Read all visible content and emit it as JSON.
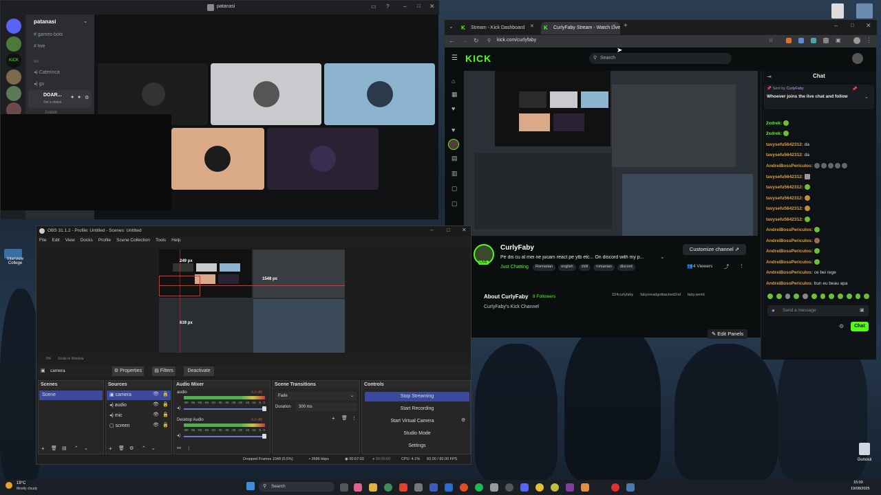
{
  "discord": {
    "window_title": "patanasi",
    "server_name": "patanasi",
    "channels": [
      "games-bots",
      "live"
    ],
    "voice_section": "Vo",
    "voice_users": [
      "Caterinca",
      "gv"
    ],
    "user_tile_name": "DOAR...",
    "user_status": "Set a status",
    "extra_user": "2xdrek"
  },
  "browser": {
    "tabs": [
      {
        "label": "Stream - Kick Dashboard"
      },
      {
        "label": "CurlyFaby Stream - Watch Live"
      }
    ],
    "url": "kick.com/curlyfaby",
    "search_placeholder": "Search",
    "logo": "KICK",
    "streamer": {
      "name": "CurlyFaby",
      "title": "Pe dis cu al mei ne jucam react pe ytb etc... On discord with my p...",
      "category": "Just Chatting",
      "tags": [
        "Romanian",
        "english",
        "chill",
        "romanian",
        "discord"
      ],
      "viewers": "4 Viewers",
      "live_badge": "LIVE",
      "customize_label": "Customize channel",
      "about_title": "About CurlyFaby",
      "followers": "8 Followers",
      "about_text": "CurlyFaby's Kick Channel",
      "socials": [
        "224curlyfaby",
        "fabyvreadgotbacked2nd",
        "faby.weird"
      ],
      "edit_panels": "Edit Panels"
    },
    "chat": {
      "title": "Chat",
      "pinned_by": "Sent by",
      "pinned_user": "CurlyFaby",
      "pinned_message": "Whoever joins the live chat and follow",
      "messages": [
        {
          "user": "2xdrek:",
          "text": ""
        },
        {
          "user": "2xdrek:",
          "text": ""
        },
        {
          "user": "tavysefu5642312:",
          "text": "da"
        },
        {
          "user": "tavysefu5642312:",
          "text": "da"
        },
        {
          "user": "AndreiBossPericulos:",
          "text": ""
        },
        {
          "user": "tavysefu5642312:",
          "text": ""
        },
        {
          "user": "tavysefu5642312:",
          "text": ""
        },
        {
          "user": "tavysefu5642312:",
          "text": ""
        },
        {
          "user": "tavysefu5642312:",
          "text": ""
        },
        {
          "user": "tavysefu5642312:",
          "text": ""
        },
        {
          "user": "AndreiBossPericulos:",
          "text": ""
        },
        {
          "user": "AndreiBossPericulos:",
          "text": ""
        },
        {
          "user": "AndreiBossPericulos:",
          "text": ""
        },
        {
          "user": "AndreiBossPericulos:",
          "text": ""
        },
        {
          "user": "AndreiBossPericulos:",
          "text": "ce bei rege"
        },
        {
          "user": "AndreiBossPericulos:",
          "text": "bun eu beau apa"
        }
      ],
      "input_placeholder": "Send a message",
      "send_label": "Chat"
    }
  },
  "obs": {
    "title": "OBS 31.1.2 - Profile: Untitled - Scenes: Untitled",
    "menu": [
      "File",
      "Edit",
      "View",
      "Docks",
      "Profile",
      "Scene Collection",
      "Tools",
      "Help"
    ],
    "dims": [
      "249 px",
      "1548 px",
      "619 px"
    ],
    "preview_bar": [
      "0%",
      "Scale to Window"
    ],
    "source_bar": {
      "name": "camera",
      "properties": "Properties",
      "filters": "Filters",
      "deactivate": "Deactivate"
    },
    "scenes": {
      "header": "Scenes",
      "items": [
        "Scene"
      ]
    },
    "sources": {
      "header": "Sources",
      "items": [
        "camera",
        "audio",
        "mic",
        "screen"
      ]
    },
    "mixer": {
      "header": "Audio Mixer",
      "channels": [
        {
          "name": "audio",
          "db": "0.0 dB"
        },
        {
          "name": "Desktop Audio",
          "db": "0.0 dB"
        }
      ],
      "scale": [
        "-60",
        "-55",
        "-50",
        "-45",
        "-40",
        "-35",
        "-30",
        "-25",
        "-20",
        "-15",
        "-10",
        "-5",
        "0"
      ]
    },
    "transitions": {
      "header": "Scene Transitions",
      "type": "Fade",
      "duration_label": "Duration",
      "duration": "300 ms"
    },
    "controls": {
      "header": "Controls",
      "stop_streaming": "Stop Streaming",
      "start_recording": "Start Recording",
      "start_virtual_camera": "Start Virtual Camera",
      "studio_mode": "Studio Mode",
      "settings": "Settings"
    },
    "status": {
      "dropped": "Dropped Frames 1048 (0.5%)",
      "bitrate": "2686 kbps",
      "stream_time": "00:57:03",
      "rec_time": "00:00:00",
      "cpu": "CPU: 4.1%",
      "fps": "60.00 / 60.00 FPS"
    }
  },
  "desktop": {
    "left_icon_label": "Interview College",
    "recycle_bin": "Gunoiul"
  },
  "taskbar": {
    "weather_temp": "19°C",
    "weather_desc": "Mostly cloudy",
    "search": "Search",
    "time": "15:00",
    "date": "19/08/2025"
  },
  "colors": {
    "kick_green": "#53fc18",
    "obs_active": "#3c4a9e",
    "discord_bg": "#1e1f22"
  }
}
